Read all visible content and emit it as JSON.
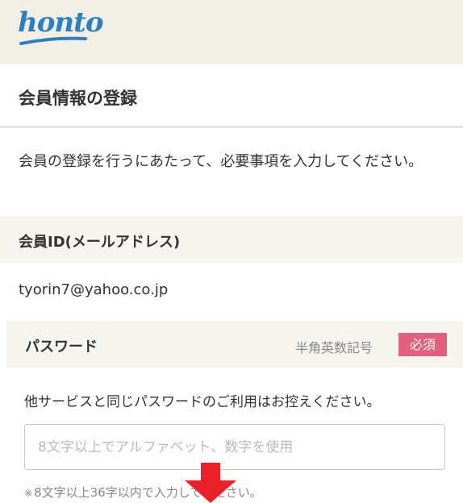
{
  "header": {
    "logo_text": "honto",
    "brand_color": "#2e7fc1"
  },
  "page": {
    "title": "会員情報の登録",
    "intro": "会員の登録を行うにあたって、必要事項を入力してください。"
  },
  "member_id": {
    "label": "会員ID(メールアドレス)",
    "value": "tyorin7@yahoo.co.jp"
  },
  "password": {
    "label": "パスワード",
    "hint": "半角英数記号",
    "required_badge": "必須",
    "required_color": "#e0607e",
    "note": "他サービスと同じパスワードのご利用はお控えください。",
    "placeholder": "8文字以上でアルファベット、数字を使用",
    "rule_mark": "※",
    "rule": "8文字以上36字以内で入力してください。"
  },
  "overlay": {
    "icon": "arrow-down-icon",
    "color": "#e8212a"
  }
}
